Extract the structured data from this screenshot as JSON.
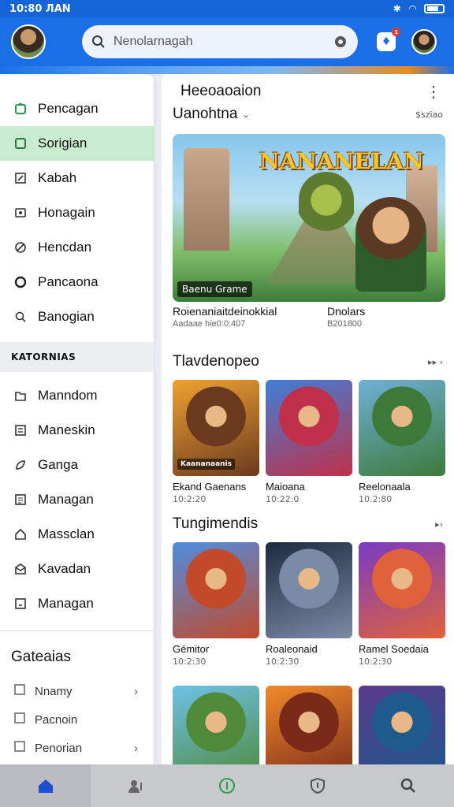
{
  "status": {
    "time": "10:80 ЛАN"
  },
  "appbar": {
    "search_placeholder": "Nenolarnagah",
    "badge": "1"
  },
  "sidebar": {
    "items": [
      {
        "label": "Pencagan",
        "icon": "app-icon"
      },
      {
        "label": "Sorigian",
        "icon": "square-icon",
        "active": true
      },
      {
        "label": "Kabah",
        "icon": "edit-icon"
      },
      {
        "label": "Honagain",
        "icon": "image-icon"
      },
      {
        "label": "Hencdan",
        "icon": "circle-slash-icon"
      },
      {
        "label": "Pancaona",
        "icon": "circle-icon"
      },
      {
        "label": "Banogian",
        "icon": "search-icon"
      }
    ],
    "section_label": "KATORNIAS",
    "category_items": [
      {
        "label": "Manndom",
        "icon": "folder-icon"
      },
      {
        "label": "Maneskin",
        "icon": "grid-icon"
      },
      {
        "label": "Ganga",
        "icon": "leaf-icon"
      },
      {
        "label": "Managan",
        "icon": "list-icon"
      },
      {
        "label": "Massclan",
        "icon": "home-icon"
      },
      {
        "label": "Kavadan",
        "icon": "mail-icon"
      },
      {
        "label": "Managan",
        "icon": "chart-icon"
      }
    ],
    "section2_title": "Gateaias",
    "sub_items": [
      {
        "label": "Nnamy",
        "chevron": true
      },
      {
        "label": "Pacnoin",
        "chevron": false
      },
      {
        "label": "Penorian",
        "chevron": true
      }
    ]
  },
  "content": {
    "header": "Heeoaoaion",
    "featured": {
      "title": "Uanohtna",
      "link": "$sziao",
      "hero_logo": "NANANELAN",
      "hero_caption": "Baenu Grame",
      "meta": [
        {
          "title": "Roienaniaitdeinokkial",
          "sub": "Aadaae hie0:0:407"
        },
        {
          "title": "Dnolars",
          "sub": "B201800"
        }
      ]
    },
    "section1": {
      "title": "Tlavdenopeo",
      "link": "▸▸ ›",
      "cards": [
        {
          "title": "Ekand Gaenans",
          "sub": "10:2:20",
          "tag": "Kaananaanis",
          "c1": "#f0a230",
          "c2": "#6b3a1e"
        },
        {
          "title": "Maioana",
          "sub": "10:22:0",
          "tag": "",
          "c1": "#3f7fd6",
          "c2": "#c0304a"
        },
        {
          "title": "Reelonaala",
          "sub": "10.2:80",
          "tag": "",
          "c1": "#6fb0d8",
          "c2": "#3d7a3a"
        }
      ]
    },
    "section2": {
      "title": "Tungimendis",
      "link": "▸›",
      "cards": [
        {
          "title": "Gémitor",
          "sub": "10:2:30",
          "tag": "",
          "c1": "#4f8de0",
          "c2": "#c24a2a"
        },
        {
          "title": "Roaleonaid",
          "sub": "10:2:30",
          "tag": "",
          "c1": "#1d2b3f",
          "c2": "#7a8ba6"
        },
        {
          "title": "Ramel Soedaia",
          "sub": "10:2:30",
          "tag": "",
          "c1": "#7a3bc4",
          "c2": "#e0623a"
        }
      ]
    },
    "section3": {
      "cards": [
        {
          "c1": "#6ec1e8",
          "c2": "#4e8a3a"
        },
        {
          "c1": "#f28b2c",
          "c2": "#7b2a1a"
        },
        {
          "c1": "#5a3a8a",
          "c2": "#1e5a8a"
        }
      ]
    }
  },
  "bottomnav": {
    "items": [
      "home-icon",
      "users-icon",
      "info-icon",
      "shield-icon",
      "search-icon"
    ],
    "active": 0
  },
  "colors": {
    "primary": "#1b6fe6",
    "active_nav": "#c9ecd0"
  }
}
